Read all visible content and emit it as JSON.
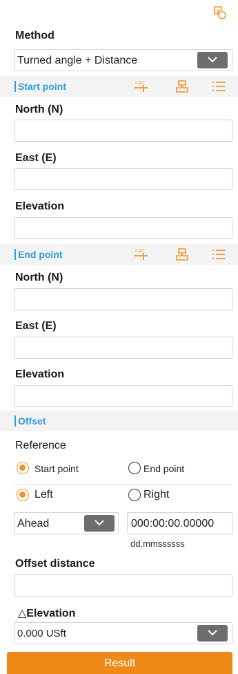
{
  "toolbar": {
    "icon": "layers-copy-icon"
  },
  "method": {
    "label": "Method",
    "value": "Turned angle + Distance"
  },
  "start_point": {
    "title": "Start point",
    "north_label": "North (N)",
    "east_label": "East (E)",
    "elevation_label": "Elevation",
    "north_value": "",
    "east_value": "",
    "elevation_value": ""
  },
  "end_point": {
    "title": "End point",
    "north_label": "North (N)",
    "east_label": "East (E)",
    "elevation_label": "Elevation",
    "north_value": "",
    "east_value": "",
    "elevation_value": ""
  },
  "offset": {
    "title": "Offset",
    "reference_label": "Reference",
    "ref_options": [
      "Start point",
      "End point"
    ],
    "ref_selected": "Start point",
    "side_options": [
      "Left",
      "Right"
    ],
    "side_selected": "Left",
    "direction_value": "Ahead",
    "angle_value": "000:00:00.00000",
    "angle_format": "dd.mmssssss",
    "offset_distance_label": "Offset distance",
    "offset_distance_value": "",
    "delta_elevation_label": "△Elevation",
    "delta_elevation_value": "0.000 USft"
  },
  "result_label": "Result",
  "colors": {
    "accent": "#f39521",
    "section_title": "#2e9ae3",
    "button": "#f08a16"
  }
}
